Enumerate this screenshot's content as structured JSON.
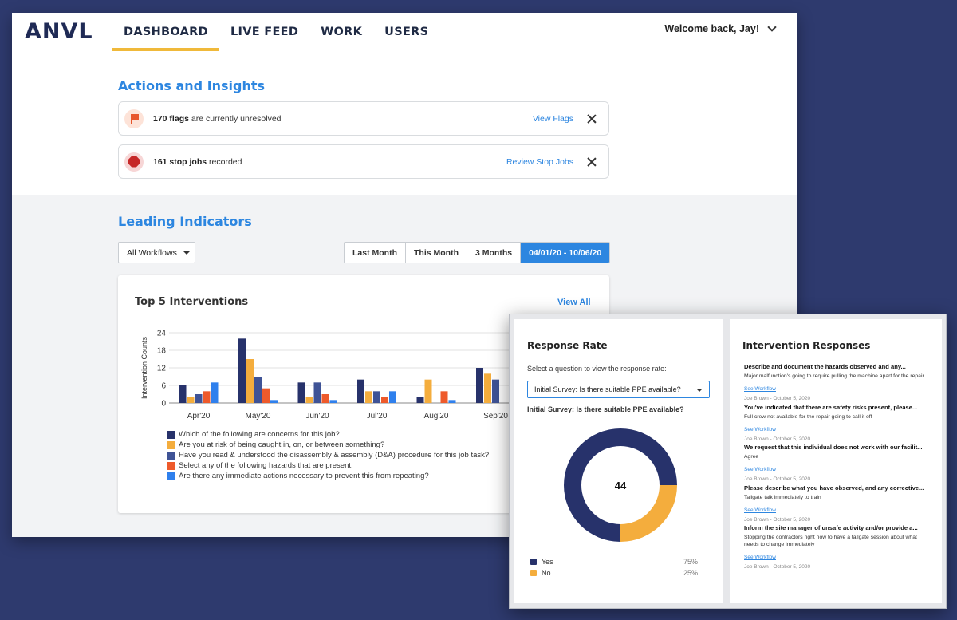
{
  "header": {
    "logo": "ANVL",
    "nav": [
      "DASHBOARD",
      "LIVE FEED",
      "WORK",
      "USERS"
    ],
    "active_nav": "DASHBOARD",
    "welcome": "Welcome back, Jay!"
  },
  "actions": {
    "title": "Actions and Insights",
    "alerts": [
      {
        "count": "170 flags",
        "text": " are currently unresolved",
        "link": "View Flags",
        "icon": "flag-icon"
      },
      {
        "count": "161 stop jobs",
        "text": " recorded",
        "link": "Review Stop Jobs",
        "icon": "stop-icon"
      }
    ]
  },
  "leading": {
    "title": "Leading Indicators",
    "workflow_filter": "All Workflows",
    "date_tabs": [
      "Last Month",
      "This Month",
      "3 Months",
      "04/01/20 - 10/06/20"
    ],
    "active_tab": "04/01/20 - 10/06/20"
  },
  "interventions_card": {
    "title": "Top 5 Interventions",
    "view_all": "View All"
  },
  "chart_data": {
    "type": "bar",
    "categories": [
      "Apr'20",
      "May'20",
      "Jun'20",
      "Jul'20",
      "Aug'20",
      "Sep'20"
    ],
    "ylabel": "Intervention Counts",
    "ylim": [
      0,
      24
    ],
    "yticks": [
      0,
      6,
      12,
      18,
      24
    ],
    "grid": true,
    "legend_placement": "bottom-left",
    "series": [
      {
        "name": "Which of the following are concerns for this job?",
        "color": "#27326b",
        "values": [
          6,
          22,
          7,
          8,
          2,
          12
        ]
      },
      {
        "name": "Are you at risk of being caught in, on, or between something?",
        "color": "#f4ad3d",
        "values": [
          2,
          15,
          2,
          4,
          8,
          10
        ]
      },
      {
        "name": "Have you read & understood the disassembly & assembly (D&A) procedure for this job task?",
        "color": "#3f5396",
        "values": [
          3,
          9,
          7,
          4,
          0,
          8
        ]
      },
      {
        "name": "Select any of the following hazards that are present:",
        "color": "#ee5a2b",
        "values": [
          4,
          5,
          3,
          2,
          4,
          0
        ]
      },
      {
        "name": "Are there any immediate actions necessary to prevent this from repeating?",
        "color": "#2f80ed",
        "values": [
          7,
          1,
          1,
          4,
          1,
          0
        ]
      }
    ]
  },
  "response_rate": {
    "title": "Response Rate",
    "subtitle": "Select a question to view the response rate:",
    "selected": "Initial Survey: Is there suitable PPE available?",
    "question": "Initial Survey: Is there suitable PPE available?",
    "total": "44",
    "slices": [
      {
        "label": "Yes",
        "pct": "75%",
        "value": 75,
        "color": "#27326b"
      },
      {
        "label": "No",
        "pct": "25%",
        "value": 25,
        "color": "#f4ad3d"
      }
    ]
  },
  "responses": {
    "title": "Intervention Responses",
    "items": [
      {
        "q": "Describe and document the hazards observed and any...",
        "a": "Major malfunction's going to require pulling the machine apart for the repair",
        "link": "See Workflow",
        "meta": "Joe Brown - October 5, 2020"
      },
      {
        "q": "You've indicated that there are safety risks present, please...",
        "a": "Full crew not available for the repair going to call it off",
        "link": "See Workflow",
        "meta": "Joe Brown - October 5, 2020"
      },
      {
        "q": "We request that this individual does not work with our facilit...",
        "a": "Agree",
        "link": "See Workflow",
        "meta": "Joe Brown - October 5, 2020"
      },
      {
        "q": "Please describe what you have observed, and any corrective...",
        "a": "Tailgate talk immediately to train",
        "link": "See Workflow",
        "meta": "Joe Brown - October 5, 2020"
      },
      {
        "q": "Inform the site manager of unsafe activity and/or provide a...",
        "a": "Stopping the contractors right now to have a tailgate session about what needs to change immediately",
        "link": "See Workflow",
        "meta": "Joe Brown - October 5, 2020"
      }
    ]
  }
}
